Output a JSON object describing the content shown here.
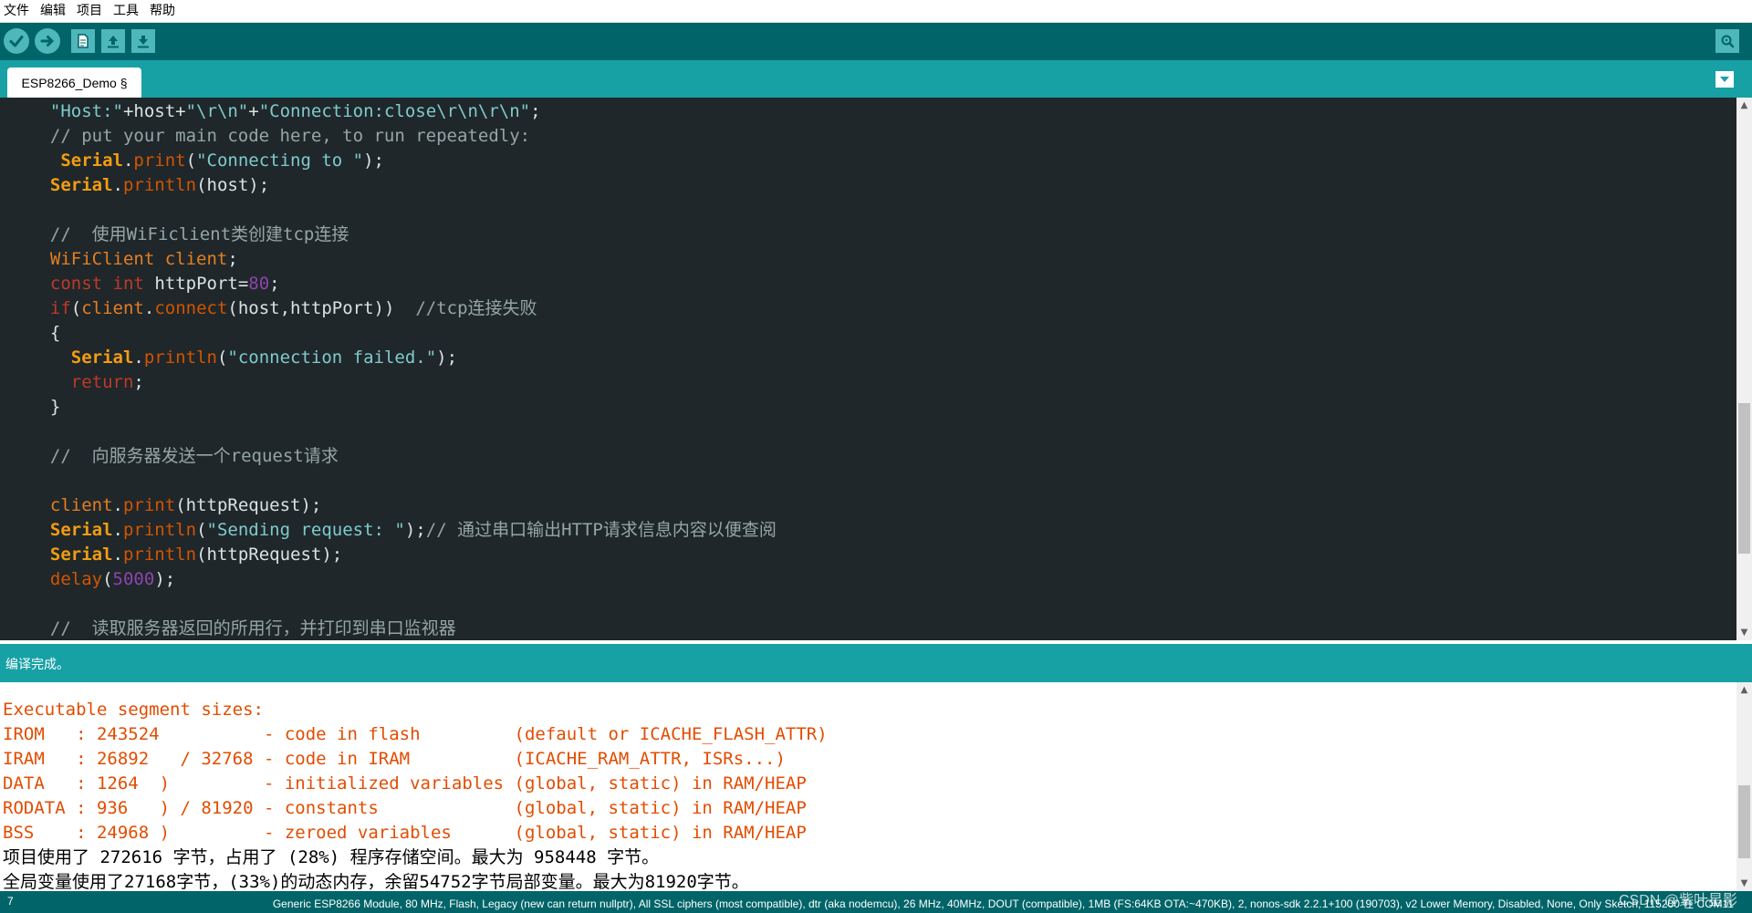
{
  "menu": [
    "文件",
    "编辑",
    "项目",
    "工具",
    "帮助"
  ],
  "toolbar": {
    "buttons": [
      "verify",
      "upload",
      "new",
      "open",
      "save"
    ],
    "serial_monitor": "serial-monitor"
  },
  "tabs": [
    {
      "label": "ESP8266_Demo §"
    }
  ],
  "colors": {
    "toolbar_bg": "#006468",
    "tabbar_bg": "#17a1a5",
    "editor_bg": "#1f272a",
    "console_error": "#e34c00"
  },
  "editor": {
    "lines": [
      [
        {
          "t": "  ",
          "c": "plain"
        },
        {
          "t": "\"Host:\"",
          "c": "str"
        },
        {
          "t": "+host+",
          "c": "plain"
        },
        {
          "t": "\"\\r\\n\"",
          "c": "str"
        },
        {
          "t": "+",
          "c": "plain"
        },
        {
          "t": "\"Connection:close\\r\\n\\r\\n\"",
          "c": "str"
        },
        {
          "t": ";",
          "c": "plain"
        }
      ],
      [
        {
          "t": "  // put your main code here, to run repeatedly:",
          "c": "comment"
        }
      ],
      [
        {
          "t": "   ",
          "c": "plain"
        },
        {
          "t": "Serial",
          "c": "obj"
        },
        {
          "t": ".",
          "c": "plain"
        },
        {
          "t": "print",
          "c": "func"
        },
        {
          "t": "(",
          "c": "plain"
        },
        {
          "t": "\"Connecting to \"",
          "c": "str"
        },
        {
          "t": ");",
          "c": "plain"
        }
      ],
      [
        {
          "t": "  ",
          "c": "plain"
        },
        {
          "t": "Serial",
          "c": "obj"
        },
        {
          "t": ".",
          "c": "plain"
        },
        {
          "t": "println",
          "c": "func"
        },
        {
          "t": "(host);",
          "c": "plain"
        }
      ],
      [
        {
          "t": "",
          "c": "plain"
        }
      ],
      [
        {
          "t": "  //  使用WiFiclient类创建tcp连接",
          "c": "comment"
        }
      ],
      [
        {
          "t": "  ",
          "c": "plain"
        },
        {
          "t": "WiFiClient",
          "c": "class"
        },
        {
          "t": " ",
          "c": "plain"
        },
        {
          "t": "client",
          "c": "class"
        },
        {
          "t": ";",
          "c": "plain"
        }
      ],
      [
        {
          "t": "  ",
          "c": "plain"
        },
        {
          "t": "const",
          "c": "kw"
        },
        {
          "t": " ",
          "c": "plain"
        },
        {
          "t": "int",
          "c": "kw"
        },
        {
          "t": " httpPort=",
          "c": "plain"
        },
        {
          "t": "80",
          "c": "num"
        },
        {
          "t": ";",
          "c": "plain"
        }
      ],
      [
        {
          "t": "  ",
          "c": "plain"
        },
        {
          "t": "if",
          "c": "kw"
        },
        {
          "t": "(",
          "c": "plain"
        },
        {
          "t": "client",
          "c": "class"
        },
        {
          "t": ".",
          "c": "plain"
        },
        {
          "t": "connect",
          "c": "func"
        },
        {
          "t": "(host,httpPort))  ",
          "c": "plain"
        },
        {
          "t": "//tcp连接失败",
          "c": "comment"
        }
      ],
      [
        {
          "t": "  {",
          "c": "plain"
        }
      ],
      [
        {
          "t": "    ",
          "c": "plain"
        },
        {
          "t": "Serial",
          "c": "obj"
        },
        {
          "t": ".",
          "c": "plain"
        },
        {
          "t": "println",
          "c": "func"
        },
        {
          "t": "(",
          "c": "plain"
        },
        {
          "t": "\"connection failed.\"",
          "c": "str"
        },
        {
          "t": ");",
          "c": "plain"
        }
      ],
      [
        {
          "t": "    ",
          "c": "plain"
        },
        {
          "t": "return",
          "c": "kw"
        },
        {
          "t": ";",
          "c": "plain"
        }
      ],
      [
        {
          "t": "  }",
          "c": "plain"
        }
      ],
      [
        {
          "t": "",
          "c": "plain"
        }
      ],
      [
        {
          "t": "  //  向服务器发送一个request请求",
          "c": "comment"
        }
      ],
      [
        {
          "t": "",
          "c": "plain"
        }
      ],
      [
        {
          "t": "  ",
          "c": "plain"
        },
        {
          "t": "client",
          "c": "class"
        },
        {
          "t": ".",
          "c": "plain"
        },
        {
          "t": "print",
          "c": "func"
        },
        {
          "t": "(httpRequest);",
          "c": "plain"
        }
      ],
      [
        {
          "t": "  ",
          "c": "plain"
        },
        {
          "t": "Serial",
          "c": "obj"
        },
        {
          "t": ".",
          "c": "plain"
        },
        {
          "t": "println",
          "c": "func"
        },
        {
          "t": "(",
          "c": "plain"
        },
        {
          "t": "\"Sending request: \"",
          "c": "str"
        },
        {
          "t": ");",
          "c": "plain"
        },
        {
          "t": "// 通过串口输出HTTP请求信息内容以便查阅",
          "c": "comment"
        }
      ],
      [
        {
          "t": "  ",
          "c": "plain"
        },
        {
          "t": "Serial",
          "c": "obj"
        },
        {
          "t": ".",
          "c": "plain"
        },
        {
          "t": "println",
          "c": "func"
        },
        {
          "t": "(httpRequest);",
          "c": "plain"
        }
      ],
      [
        {
          "t": "  ",
          "c": "plain"
        },
        {
          "t": "delay",
          "c": "func"
        },
        {
          "t": "(",
          "c": "plain"
        },
        {
          "t": "5000",
          "c": "num"
        },
        {
          "t": ");",
          "c": "plain"
        }
      ],
      [
        {
          "t": "",
          "c": "plain"
        }
      ],
      [
        {
          "t": "  //  读取服务器返回的所用行，并打印到串口监视器",
          "c": "comment"
        }
      ]
    ]
  },
  "status": {
    "message": "编译完成。"
  },
  "console": {
    "lines": [
      {
        "text": "Executable segment sizes:",
        "color": "orange"
      },
      {
        "text": "IROM   : 243524          - code in flash         (default or ICACHE_FLASH_ATTR)",
        "color": "orange"
      },
      {
        "text": "IRAM   : 26892   / 32768 - code in IRAM          (ICACHE_RAM_ATTR, ISRs...)",
        "color": "orange"
      },
      {
        "text": "DATA   : 1264  )         - initialized variables (global, static) in RAM/HEAP",
        "color": "orange"
      },
      {
        "text": "RODATA : 936   ) / 81920 - constants             (global, static) in RAM/HEAP",
        "color": "orange"
      },
      {
        "text": "BSS    : 24968 )         - zeroed variables      (global, static) in RAM/HEAP",
        "color": "orange"
      },
      {
        "text": "项目使用了 272616 字节，占用了 (28%) 程序存储空间。最大为 958448 字节。",
        "color": "black"
      },
      {
        "text": "全局变量使用了27168字节，(33%)的动态内存，余留54752字节局部变量。最大为81920字节。",
        "color": "black"
      }
    ]
  },
  "footer": {
    "line_number": "7",
    "board_info": "Generic ESP8266 Module, 80 MHz, Flash, Legacy (new can return nullptr), All SSL ciphers (most compatible), dtr (aka nodemcu), 26 MHz, 40MHz, DOUT (compatible), 1MB (FS:64KB OTA:~470KB), 2, nonos-sdk 2.2.1+100 (190703), v2 Lower Memory, Disabled, None, Only Sketch, 115200 在 COM11",
    "watermark": "CSDN @紫叶星影"
  }
}
